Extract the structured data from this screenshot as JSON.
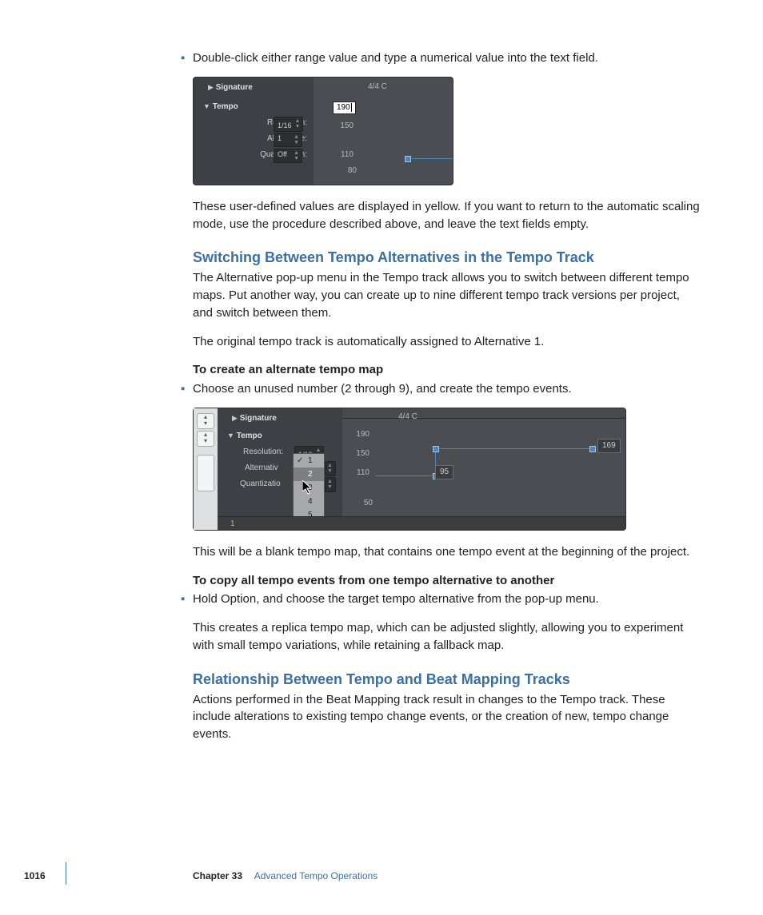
{
  "bullet_glyph": "▪",
  "b1": "Double-click either range value and type a numerical value into the text field.",
  "fig1": {
    "signature_label": "Signature",
    "tempo_label": "Tempo",
    "time_sig": "4/4  C",
    "rows": {
      "resolution": {
        "label": "Resolution:",
        "value": "1/16"
      },
      "alternative": {
        "label": "Alternative:",
        "value": "1"
      },
      "quantization": {
        "label": "Quantization:",
        "value": "Off"
      }
    },
    "edit_value": "190",
    "scale": [
      "150",
      "110",
      "80"
    ]
  },
  "p1": "These user-defined values are displayed in yellow. If you want to return to the automatic scaling mode, use the procedure described above, and leave the text fields empty.",
  "h1": "Switching Between Tempo Alternatives in the Tempo Track",
  "p2": "The Alternative pop-up menu in the Tempo track allows you to switch between different tempo maps. Put another way, you can create up to nine different tempo track versions per project, and switch between them.",
  "p3": "The original tempo track is automatically assigned to Alternative 1.",
  "s1": "To create an alternate tempo map",
  "b2": "Choose an unused number (2 through 9), and create the tempo events.",
  "fig2": {
    "signature_label": "Signature",
    "tempo_label": "Tempo",
    "time_sig": "4/4  C",
    "rows": {
      "resolution": {
        "label": "Resolution:",
        "value": "1/16"
      },
      "alternative": {
        "label": "Alternativ"
      },
      "quantization": {
        "label": "Quantizatio"
      }
    },
    "scale": [
      "190",
      "150",
      "110",
      "50"
    ],
    "popup": [
      "1",
      "2",
      "3",
      "4",
      "5"
    ],
    "flag_mid": "95",
    "flag_right": "169"
  },
  "p4": "This will be a blank tempo map, that contains one tempo event at the beginning of the project.",
  "s2": "To copy all tempo events from one tempo alternative to another",
  "b3": "Hold Option, and choose the target tempo alternative from the pop-up menu.",
  "p5": "This creates a replica tempo map, which can be adjusted slightly, allowing you to experiment with small tempo variations, while retaining a fallback map.",
  "h2": "Relationship Between Tempo and Beat Mapping Tracks",
  "p6": "Actions performed in the Beat Mapping track result in changes to the Tempo track. These include alterations to existing tempo change events, or the creation of new, tempo change events.",
  "footer": {
    "page": "1016",
    "chapter_label": "Chapter 33",
    "chapter_title": "Advanced Tempo Operations"
  }
}
